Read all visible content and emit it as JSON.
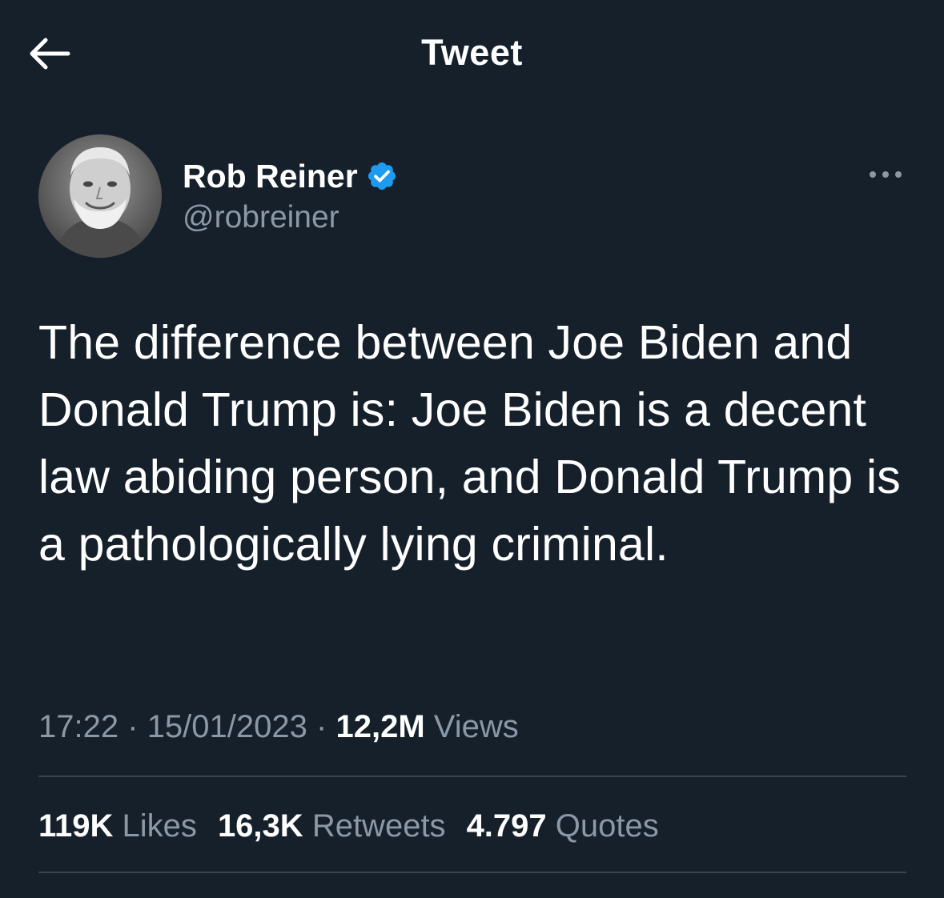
{
  "header": {
    "title": "Tweet",
    "back_icon": "arrow-left-icon"
  },
  "author": {
    "display_name": "Rob Reiner",
    "handle": "@robreiner",
    "verified_icon": "verified-badge-icon",
    "verified_color": "#1d9bf0",
    "more_icon": "more-horizontal-icon"
  },
  "tweet": {
    "text": "The difference between Joe Biden and Donald Trump is: Joe Biden is a decent law abiding person, and Donald Trump is a pathologically lying criminal.",
    "time": "17:22",
    "separator": "·",
    "date": "15/01/2023",
    "views_count": "12,2M",
    "views_label": "Views"
  },
  "stats": {
    "likes_count": "119K",
    "likes_label": "Likes",
    "retweets_count": "16,3K",
    "retweets_label": "Retweets",
    "quotes_count": "4.797",
    "quotes_label": "Quotes"
  },
  "colors": {
    "background": "#15202b",
    "secondary_text": "#8b98a5",
    "divider": "#38444d"
  }
}
